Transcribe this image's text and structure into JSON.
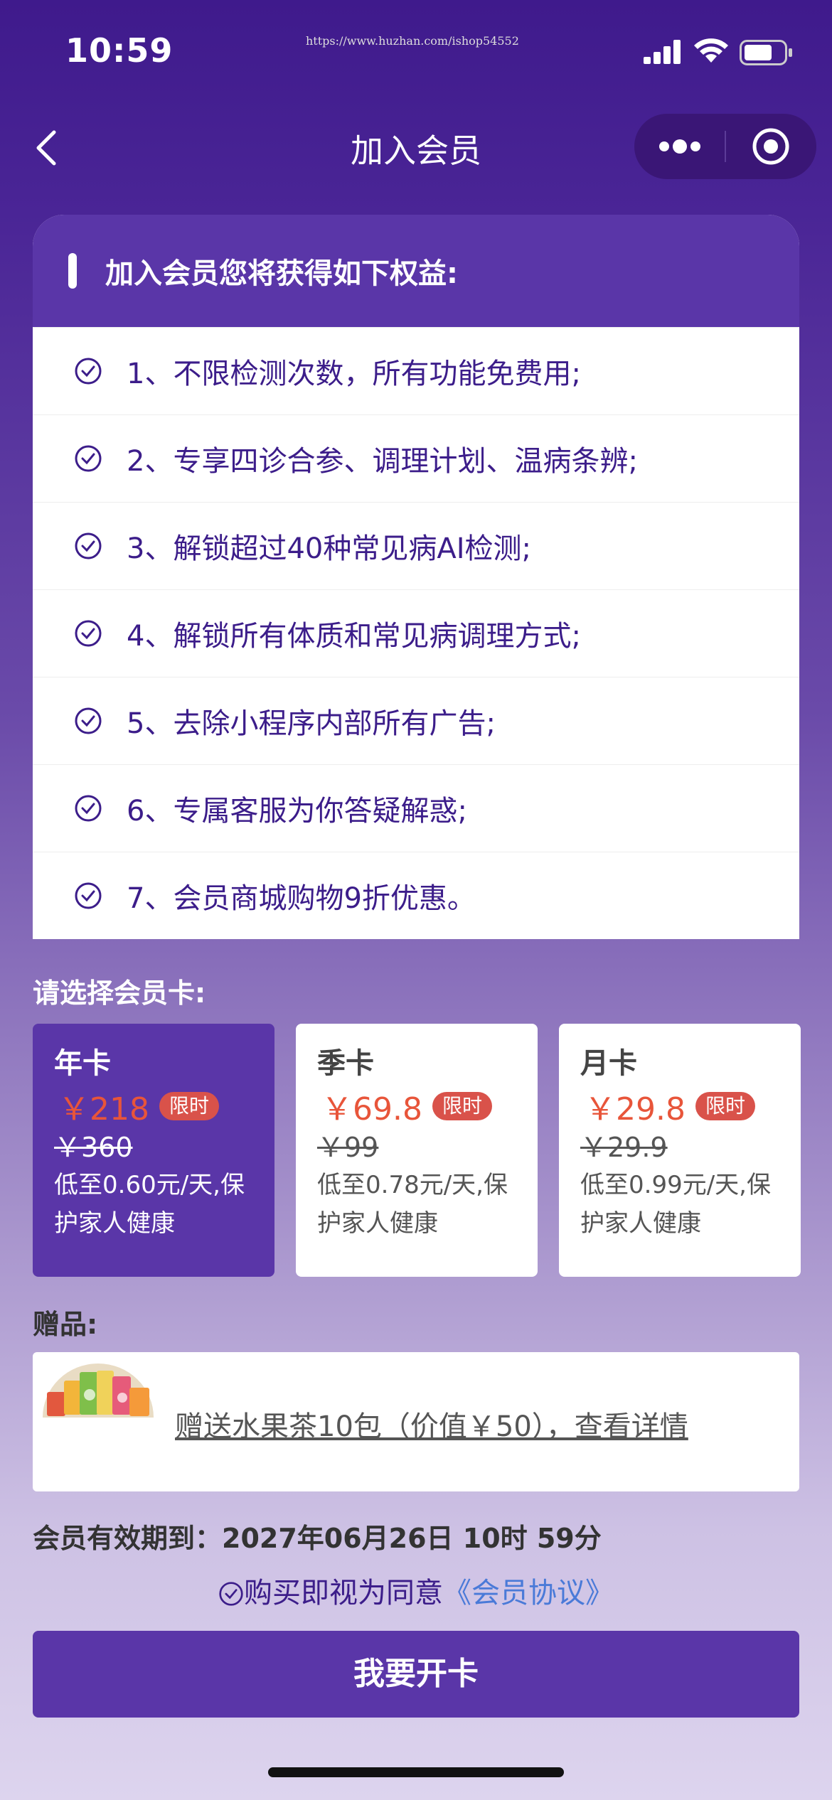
{
  "status": {
    "time": "10:59",
    "url": "https://www.huzhan.com/ishop54552"
  },
  "nav": {
    "title": "加入会员",
    "icons": [
      "chevron-left-icon",
      "more-dots-icon",
      "target-icon"
    ]
  },
  "benefits": {
    "header": "加入会员您将获得如下权益:",
    "items": [
      "1、不限检测次数，所有功能免费用;",
      "2、专享四诊合参、调理计划、温病条辨;",
      "3、解锁超过40种常见病AI检测;",
      "4、解锁所有体质和常见病调理方式;",
      "5、去除小程序内部所有广告;",
      "6、专属客服为你答疑解惑;",
      "7、会员商城购物9折优惠。"
    ]
  },
  "plans": {
    "label": "请选择会员卡:",
    "cards": [
      {
        "name": "年卡",
        "price": "￥218",
        "tag": "限时",
        "original": "￥360",
        "desc": "低至0.60元/天,保护家人健康",
        "selected": true
      },
      {
        "name": "季卡",
        "price": "￥69.8",
        "tag": "限时",
        "original": "￥99",
        "desc": "低至0.78元/天,保护家人健康",
        "selected": false
      },
      {
        "name": "月卡",
        "price": "￥29.8",
        "tag": "限时",
        "original": "￥29.9",
        "desc": "低至0.99元/天,保护家人健康",
        "selected": false
      }
    ]
  },
  "gift": {
    "label": "赠品:",
    "text": "赠送水果茶10包（价值￥50），查看详情"
  },
  "validity": "会员有效期到：2027年06月26日 10时 59分",
  "agreement": {
    "prefix": "购买即视为同意",
    "link": "《会员协议》"
  },
  "cta": "我要开卡",
  "colors": {
    "primary": "#5a36a8",
    "price": "#e8553a",
    "tag": "#d9524a",
    "link": "#4a7ad8"
  }
}
